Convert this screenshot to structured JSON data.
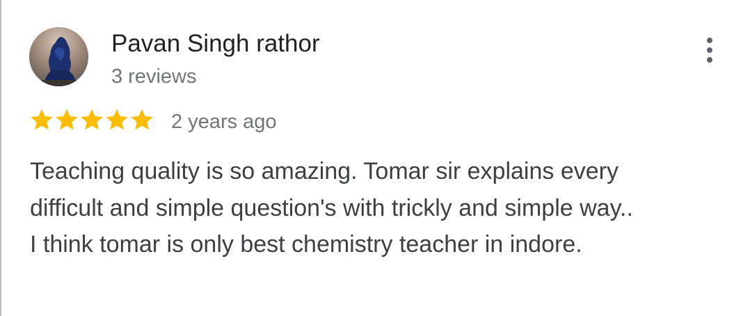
{
  "review": {
    "reviewer_name": "Pavan Singh rathor",
    "review_count": "3 reviews",
    "rating": 5,
    "rating_max": 5,
    "time_ago": "2 years ago",
    "text": "Teaching quality is so amazing. Tomar sir explains every difficult and simple question's with trickly and simple way.. I think tomar is only best chemistry teacher in indore."
  },
  "icons": {
    "avatar": "avatar-photo",
    "menu": "more-vert-icon",
    "star": "star-icon"
  },
  "colors": {
    "star": "#fbbc04",
    "name": "#202124",
    "secondary": "#70757a",
    "body": "#3c4043",
    "menu": "#5f6368"
  }
}
